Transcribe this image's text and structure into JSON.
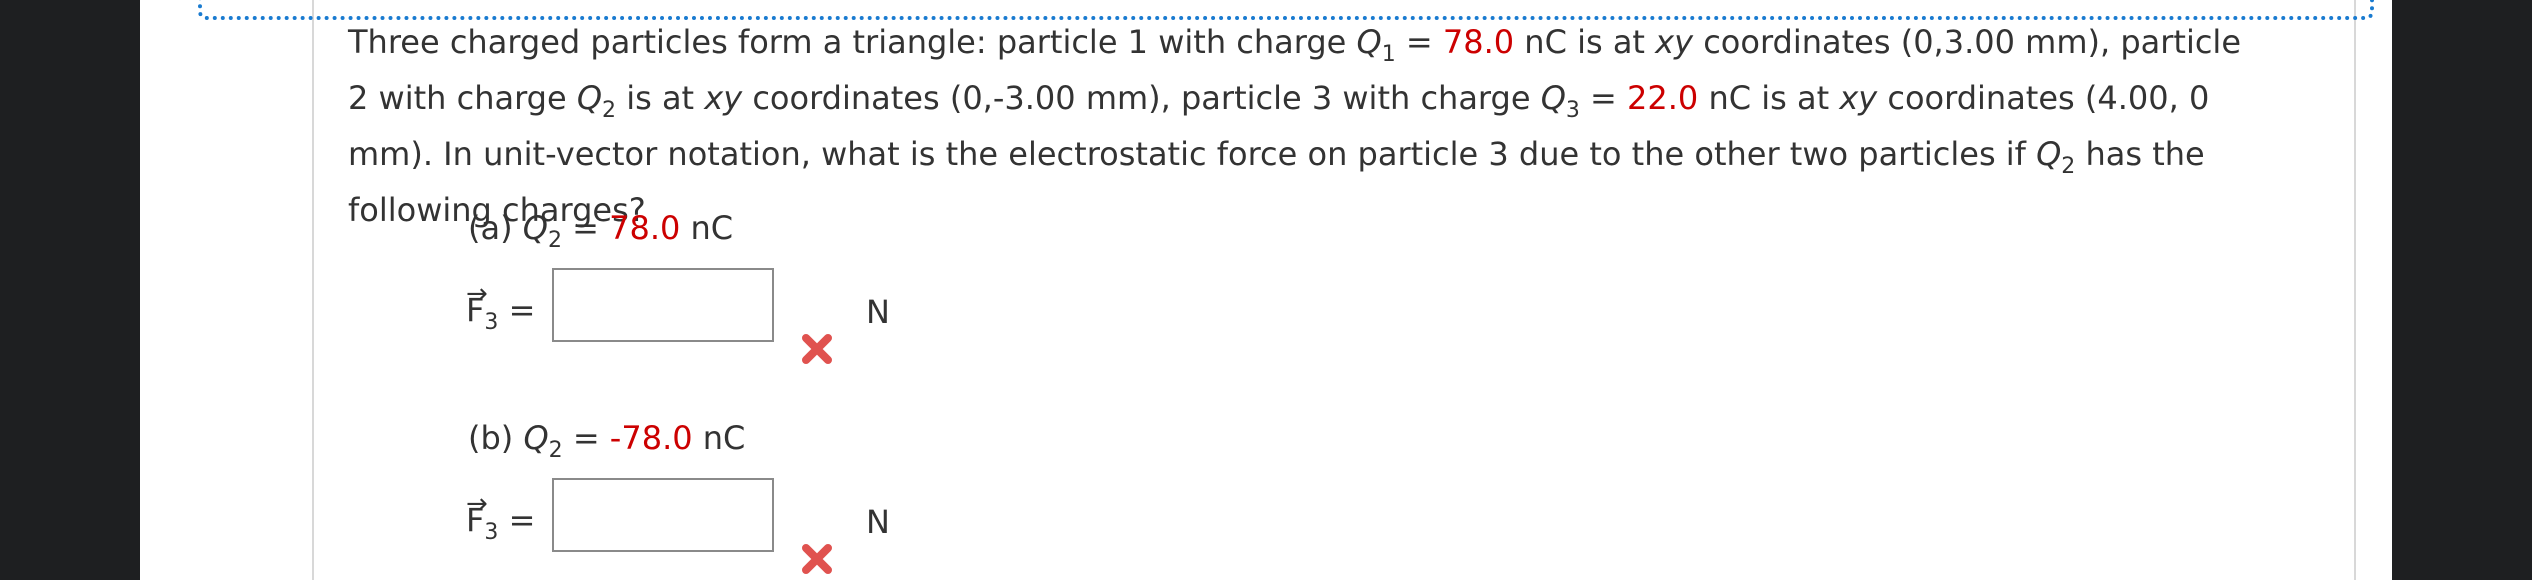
{
  "question": {
    "t1": "Three charged particles form a triangle: particle 1 with charge ",
    "q1_sym": "Q",
    "q1_sub": "1",
    "eq1": " = ",
    "q1_val": "78.0",
    "t2": " nC is at ",
    "xy1": "xy",
    "t3": " coordinates (0,3.00 mm), particle 2 with charge ",
    "q2_sym": "Q",
    "q2_sub": "2",
    "t4": " is at ",
    "xy2": "xy",
    "t5": " coordinates (0,-3.00 mm), particle 3 with charge ",
    "q3_sym": "Q",
    "q3_sub": "3",
    "eq3": " = ",
    "q3_val": "22.0",
    "t6": " nC is at ",
    "xy3": "xy",
    "t7": " coordinates (4.00, 0 mm). In unit-vector notation, what is the electrostatic force on particle 3 due to the other two particles if ",
    "q2b_sym": "Q",
    "q2b_sub": "2",
    "t8": " has the following charges?"
  },
  "parts": [
    {
      "label": "(a)",
      "q_sym": "Q",
      "q_sub": "2",
      "eq": " = ",
      "value": "78.0",
      "unit_q": " nC",
      "force_sym": "F",
      "force_sub": "3",
      "force_eq": " =",
      "answer_value": "",
      "answer_unit": "N",
      "status_icon": "red-x-icon"
    },
    {
      "label": "(b)",
      "q_sym": "Q",
      "q_sub": "2",
      "eq": " = ",
      "value": "-78.0",
      "unit_q": " nC",
      "force_sym": "F",
      "force_sub": "3",
      "force_eq": " =",
      "answer_value": "",
      "answer_unit": "N",
      "status_icon": "red-x-icon"
    }
  ],
  "colors": {
    "accent_red": "#cc0000",
    "focus_blue": "#1a7bd0",
    "x_icon": "#e0524f"
  }
}
